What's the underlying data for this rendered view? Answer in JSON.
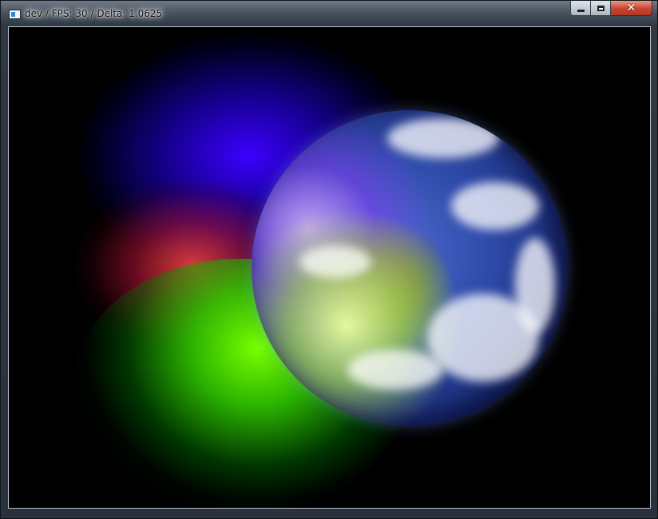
{
  "window": {
    "title": "dev / FPS: 30 / Delta: 1.0625",
    "icon": "app-window-icon",
    "buttons": {
      "minimize_icon": "minimize-icon",
      "maximize_icon": "maximize-icon",
      "close_icon": "close-icon",
      "close_glyph": "✕"
    }
  },
  "scene": {
    "background_color": "#000000",
    "planet": "earth-planet",
    "lights": [
      {
        "name": "blue-light",
        "color": "#3c00ff"
      },
      {
        "name": "red-light",
        "color": "#ff4646"
      },
      {
        "name": "green-light",
        "color": "#78ff00"
      }
    ]
  }
}
